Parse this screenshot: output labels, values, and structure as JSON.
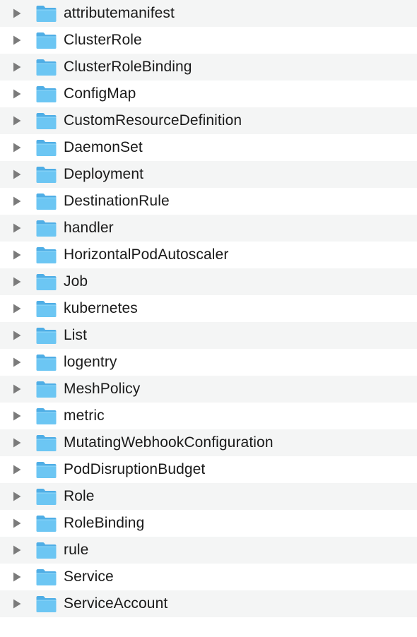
{
  "finder": {
    "icons": {
      "disclosure": "disclosure-triangle-right-icon",
      "folder": "folder-icon"
    },
    "colors": {
      "row_alt": "#f4f5f5",
      "row_base": "#ffffff",
      "folder_body": "#6cc6f3",
      "folder_tab": "#4faee6",
      "triangle": "#7b7b7b",
      "text": "#1a1a1a"
    },
    "items": [
      {
        "label": "attributemanifest"
      },
      {
        "label": "ClusterRole"
      },
      {
        "label": "ClusterRoleBinding"
      },
      {
        "label": "ConfigMap"
      },
      {
        "label": "CustomResourceDefinition"
      },
      {
        "label": "DaemonSet"
      },
      {
        "label": "Deployment"
      },
      {
        "label": "DestinationRule"
      },
      {
        "label": "handler"
      },
      {
        "label": "HorizontalPodAutoscaler"
      },
      {
        "label": "Job"
      },
      {
        "label": "kubernetes"
      },
      {
        "label": "List"
      },
      {
        "label": "logentry"
      },
      {
        "label": "MeshPolicy"
      },
      {
        "label": "metric"
      },
      {
        "label": "MutatingWebhookConfiguration"
      },
      {
        "label": "PodDisruptionBudget"
      },
      {
        "label": "Role"
      },
      {
        "label": "RoleBinding"
      },
      {
        "label": "rule"
      },
      {
        "label": "Service"
      },
      {
        "label": "ServiceAccount"
      }
    ]
  }
}
